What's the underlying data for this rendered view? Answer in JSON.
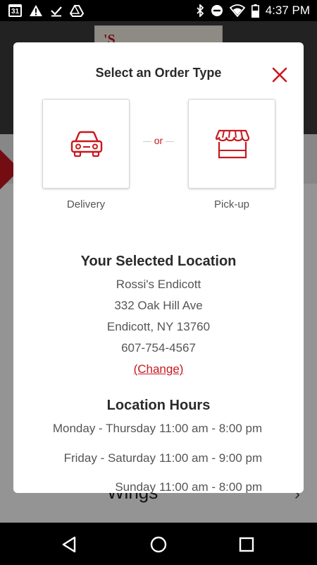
{
  "status_bar": {
    "time": "4:37 PM",
    "calendar_day": "31",
    "icons": [
      "calendar-icon",
      "alert-icon",
      "download-done-icon",
      "drive-icon",
      "bluetooth-icon",
      "do-not-disturb-icon",
      "wifi-icon",
      "battery-icon"
    ]
  },
  "background": {
    "logo_text": "'S",
    "item_label": "Wings"
  },
  "modal": {
    "title": "Select an Order Type",
    "close_icon": "close-icon",
    "or_text": "or",
    "order_types": [
      {
        "label": "Delivery",
        "icon": "car-icon"
      },
      {
        "label": "Pick-up",
        "icon": "storefront-icon"
      }
    ],
    "location": {
      "heading": "Your Selected Location",
      "name": "Rossi's Endicott",
      "street": "332 Oak Hill Ave",
      "city": "Endicott, NY 13760",
      "phone": "607-754-4567",
      "change_label": "(Change)"
    },
    "hours": {
      "heading": "Location Hours",
      "rows": [
        {
          "day": "Monday - Thursday",
          "time": "11:00 am - 8:00 pm"
        },
        {
          "day": "Friday - Saturday",
          "time": "11:00 am - 9:00 pm"
        },
        {
          "day": "Sunday",
          "time": "11:00 am - 8:00 pm"
        }
      ]
    },
    "accent_color": "#c8181f"
  },
  "nav_bar": {
    "buttons": [
      "back-icon",
      "home-icon",
      "recents-icon"
    ]
  }
}
